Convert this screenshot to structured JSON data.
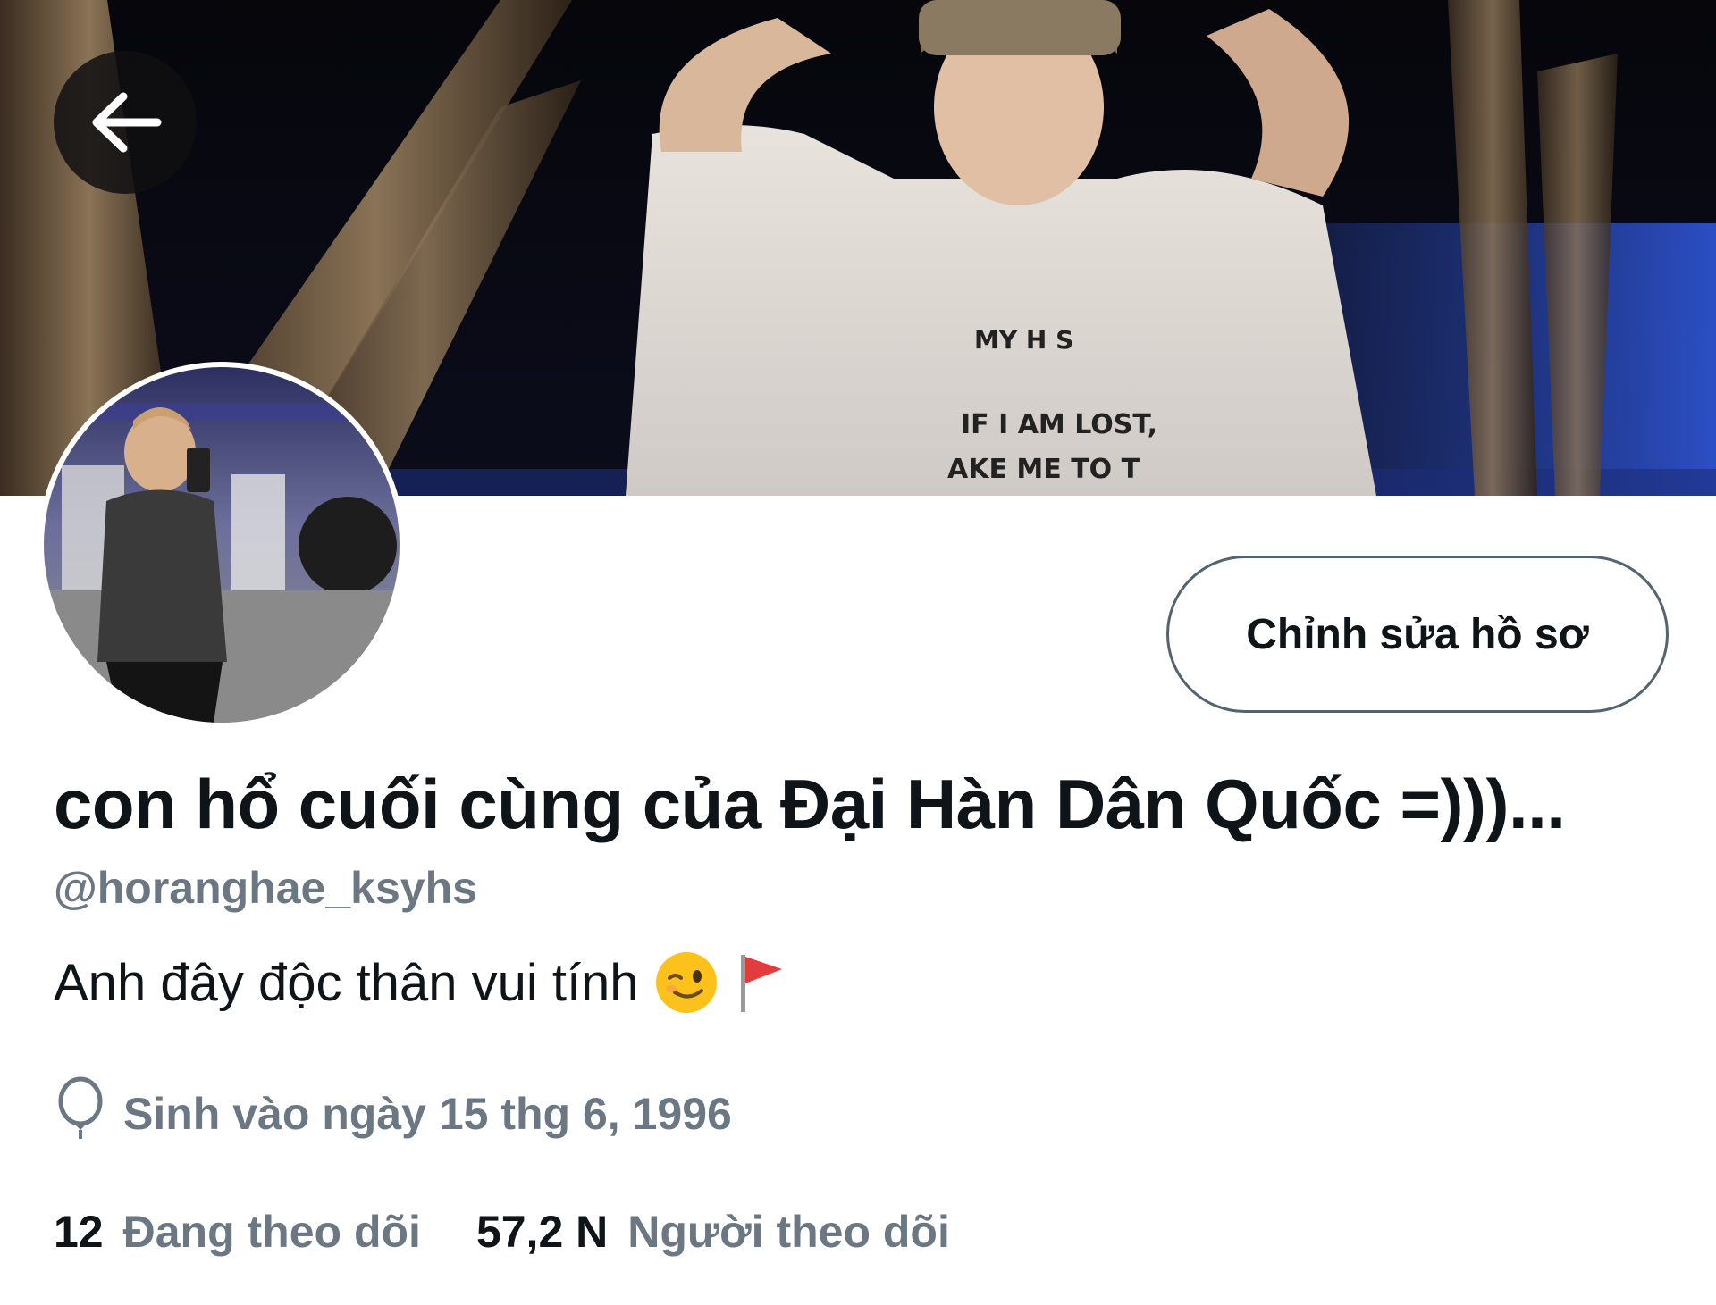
{
  "header": {
    "back_icon": "arrow-left-icon"
  },
  "banner": {
    "shirt_text_line1": "MY H S",
    "shirt_text_line2": "IF I AM LOST,",
    "shirt_text_line3": "AKE ME TO T"
  },
  "profile": {
    "edit_button_label": "Chỉnh sửa hồ sơ",
    "display_name": "con hổ cuối cùng của Đại Hàn Dân Quốc =)))...",
    "handle": "@horanghae_ksyhs",
    "bio_text": "Anh đây độc thân vui tính",
    "bio_emojis": [
      "winking-face-emoji",
      "red-flag-emoji"
    ],
    "birthday_icon": "balloon-icon",
    "birthday_text": "Sinh vào ngày 15 thg 6, 1996"
  },
  "stats": {
    "following_count": "12",
    "following_label": "Đang theo dõi",
    "followers_count": "57,2 N",
    "followers_label": "Người theo dõi"
  },
  "colors": {
    "primary_text": "#0f1419",
    "secondary_text": "#6b7883",
    "button_border": "#536471"
  }
}
